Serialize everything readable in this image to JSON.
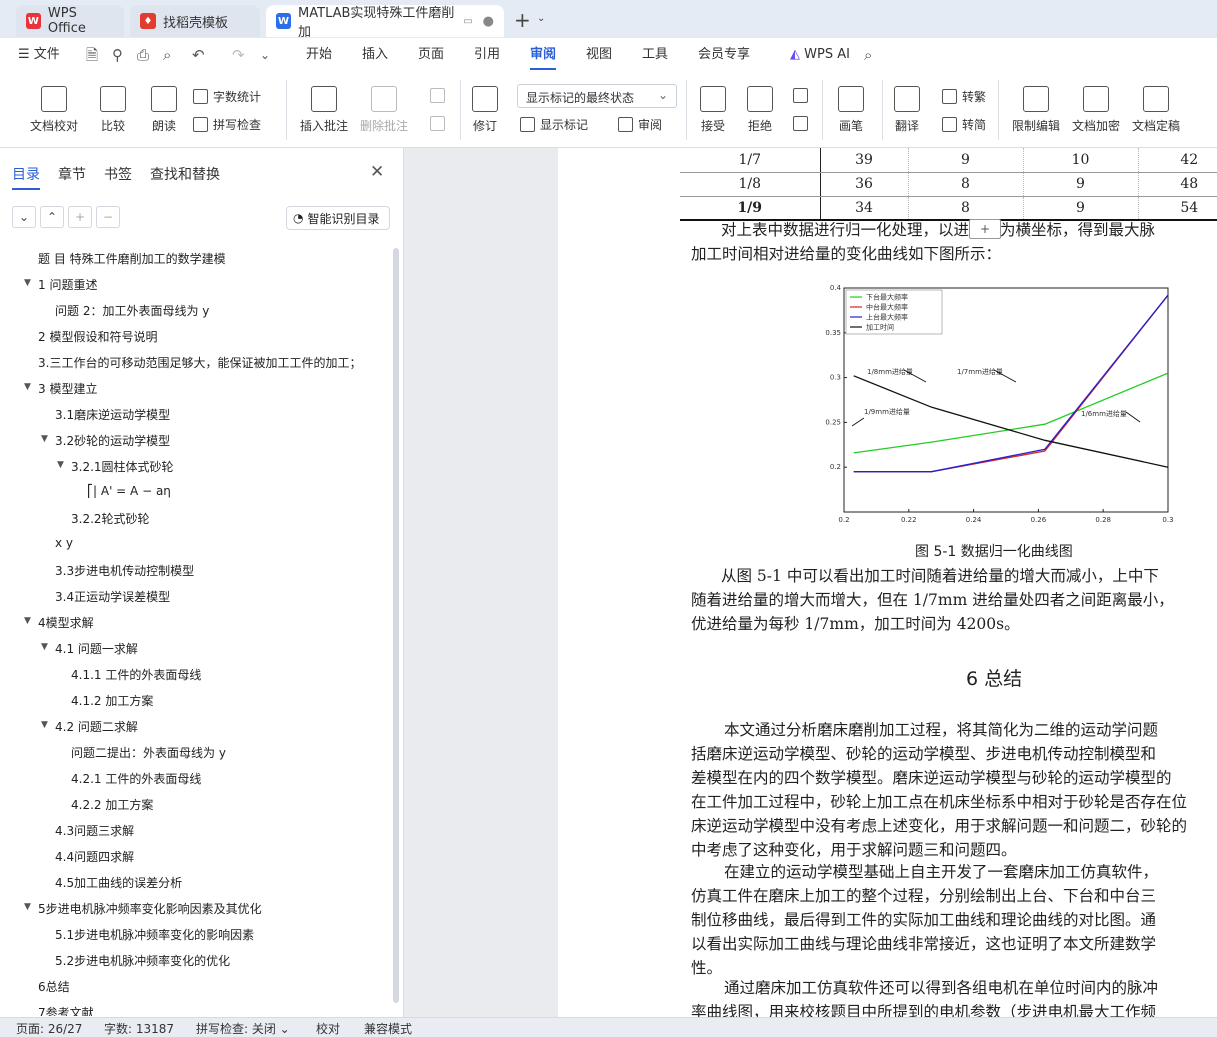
{
  "tabs": [
    {
      "label": "WPS Office",
      "icon": "wps-logo-icon"
    },
    {
      "label": "找稻壳模板",
      "icon": "daoke-icon"
    },
    {
      "label": "MATLAB实现特殊工件磨削加",
      "icon": "word-doc-icon"
    }
  ],
  "menu": {
    "file": "文件",
    "items": [
      "开始",
      "插入",
      "页面",
      "引用",
      "审阅",
      "视图",
      "工具",
      "会员专享"
    ],
    "active": "审阅",
    "ai": "WPS AI"
  },
  "ribbon": {
    "doc_check": "文档校对",
    "compare": "比较",
    "read_aloud": "朗读",
    "word_count": "字数统计",
    "spell_check": "拼写检查",
    "insert_comment": "插入批注",
    "delete_comment": "删除批注",
    "revise": "修订",
    "markup_state": "显示标记的最终状态",
    "show_markup": "显示标记",
    "review_pane": "审阅",
    "accept": "接受",
    "reject": "拒绝",
    "pen": "画笔",
    "translate": "翻译",
    "to_traditional": "转繁",
    "to_simplified": "转简",
    "restrict_edit": "限制编辑",
    "encrypt": "文档加密",
    "finalize": "文档定稿"
  },
  "sidebar": {
    "tabs": [
      "目录",
      "章节",
      "书签",
      "查找和替换"
    ],
    "smart_toc": "智能识别目录",
    "toc": [
      {
        "label": "题 目 特殊工件磨削加工的数学建模",
        "level": 0,
        "toggle": ""
      },
      {
        "label": "1 问题重述",
        "level": 0,
        "toggle": "▼"
      },
      {
        "label": "问题 2：加工外表面母线为 y",
        "level": 1,
        "toggle": ""
      },
      {
        "label": "2 模型假设和符号说明",
        "level": 0,
        "toggle": ""
      },
      {
        "label": "3.三工作台的可移动范围足够大，能保证被加工工件的加工；",
        "level": 0,
        "toggle": ""
      },
      {
        "label": "3 模型建立",
        "level": 0,
        "toggle": "▼"
      },
      {
        "label": "3.1磨床逆运动学模型",
        "level": 1,
        "toggle": ""
      },
      {
        "label": "3.2砂轮的运动学模型",
        "level": 1,
        "toggle": "▼"
      },
      {
        "label": "3.2.1圆柱体式砂轮",
        "level": 2,
        "toggle": "▼"
      },
      {
        "label": "⎡| A' = A  − aη",
        "level": 3,
        "toggle": ""
      },
      {
        "label": "3.2.2轮式砂轮",
        "level": 2,
        "toggle": ""
      },
      {
        "label": "x y",
        "level": 1,
        "toggle": ""
      },
      {
        "label": "3.3步进电机传动控制模型",
        "level": 1,
        "toggle": ""
      },
      {
        "label": "3.4正运动学误差模型",
        "level": 1,
        "toggle": ""
      },
      {
        "label": "4模型求解",
        "level": 0,
        "toggle": "▼"
      },
      {
        "label": "4.1 问题一求解",
        "level": 1,
        "toggle": "▼"
      },
      {
        "label": "4.1.1 工件的外表面母线",
        "level": 2,
        "toggle": ""
      },
      {
        "label": "4.1.2 加工方案",
        "level": 2,
        "toggle": ""
      },
      {
        "label": "4.2 问题二求解",
        "level": 1,
        "toggle": "▼"
      },
      {
        "label": "问题二提出：外表面母线为 y",
        "level": 2,
        "toggle": ""
      },
      {
        "label": "4.2.1 工件的外表面母线",
        "level": 2,
        "toggle": ""
      },
      {
        "label": "4.2.2 加工方案",
        "level": 2,
        "toggle": ""
      },
      {
        "label": "4.3问题三求解",
        "level": 1,
        "toggle": ""
      },
      {
        "label": "4.4问题四求解",
        "level": 1,
        "toggle": ""
      },
      {
        "label": "4.5加工曲线的误差分析",
        "level": 1,
        "toggle": ""
      },
      {
        "label": "5步进电机脉冲频率变化影响因素及其优化",
        "level": 0,
        "toggle": "▼"
      },
      {
        "label": "5.1步进电机脉冲频率变化的影响因素",
        "level": 1,
        "toggle": ""
      },
      {
        "label": "5.2步进电机脉冲频率变化的优化",
        "level": 1,
        "toggle": ""
      },
      {
        "label": "6总结",
        "level": 0,
        "toggle": ""
      },
      {
        "label": "7参考文献",
        "level": 0,
        "toggle": ""
      }
    ]
  },
  "document": {
    "table_rows": [
      [
        "1/7",
        "39",
        "9",
        "10",
        "42"
      ],
      [
        "1/8",
        "36",
        "8",
        "9",
        "48"
      ],
      [
        "1/9",
        "34",
        "8",
        "9",
        "54"
      ]
    ],
    "para1": [
      "对上表中数据进行归一化处理，以进给量为横坐标，得到最大脉",
      "加工时间相对进给量的变化曲线如下图所示："
    ],
    "figure_caption": "图 5-1 数据归一化曲线图",
    "para2": [
      "从图 5-1 中可以看出加工时间随着进给量的增大而减小，上中下",
      "随着进给量的增大而增大，但在 1/7mm 进给量处四者之间距离最小，",
      "优进给量为每秒 1/7mm，加工时间为 4200s。"
    ],
    "section_title": "6 总结",
    "para3": [
      "本文通过分析磨床磨削加工过程，将其简化为二维的运动学问题",
      "括磨床逆运动学模型、砂轮的运动学模型、步进电机传动控制模型和",
      "差模型在内的四个数学模型。磨床逆运动学模型与砂轮的运动学模型的",
      "在工件加工过程中，砂轮上加工点在机床坐标系中相对于砂轮是否存在位",
      "床逆运动学模型中没有考虑上述变化，用于求解问题一和问题二，砂轮的",
      "中考虑了这种变化，用于求解问题三和问题四。"
    ],
    "para4": [
      "在建立的运动学模型基础上自主开发了一套磨床加工仿真软件，",
      "仿真工件在磨床上加工的整个过程，分别绘制出上台、下台和中台三",
      "制位移曲线，最后得到工件的实际加工曲线和理论曲线的对比图。通",
      "以看出实际加工曲线与理论曲线非常接近，这也证明了本文所建数学",
      "性。"
    ],
    "para5": [
      "通过磨床加工仿真软件还可以得到各组电机在单位时间内的脉冲",
      "率曲线图，用来校核题目中所提到的电机参数（步进电机最大工作频"
    ]
  },
  "chart_data": {
    "type": "line",
    "title": "",
    "xlabel": "",
    "ylabel": "",
    "xlim": [
      0.2,
      0.3
    ],
    "ylim": [
      0.15,
      0.4
    ],
    "x_ticks": [
      "0.2",
      "0.22",
      "0.24",
      "0.26",
      "0.28",
      "0.3"
    ],
    "y_ticks": [
      "0.2",
      "0.25",
      "0.3",
      "0.35",
      "0.4"
    ],
    "series": [
      {
        "name": "下台最大频率",
        "color": "#22cc22",
        "x": [
          0.203,
          0.227,
          0.262,
          0.3
        ],
        "y": [
          0.216,
          0.228,
          0.248,
          0.305
        ]
      },
      {
        "name": "中台最大频率",
        "color": "#dd2222",
        "x": [
          0.203,
          0.227,
          0.262,
          0.3
        ],
        "y": [
          0.195,
          0.195,
          0.218,
          0.392
        ]
      },
      {
        "name": "上台最大频率",
        "color": "#2222cc",
        "x": [
          0.203,
          0.227,
          0.262,
          0.3
        ],
        "y": [
          0.195,
          0.195,
          0.22,
          0.392
        ]
      },
      {
        "name": "加工时间",
        "color": "#111111",
        "x": [
          0.203,
          0.227,
          0.262,
          0.3
        ],
        "y": [
          0.302,
          0.267,
          0.23,
          0.2
        ]
      }
    ],
    "annotations": [
      "1/8mm进给量",
      "1/7mm进给量",
      "1/9mm进给量",
      "1/6mm进给量"
    ],
    "legend": "top-left"
  },
  "status": {
    "page": "页面: 26/27",
    "words": "字数: 13187",
    "spell": "拼写检查: 关闭",
    "proof": "校对",
    "compat": "兼容模式"
  }
}
